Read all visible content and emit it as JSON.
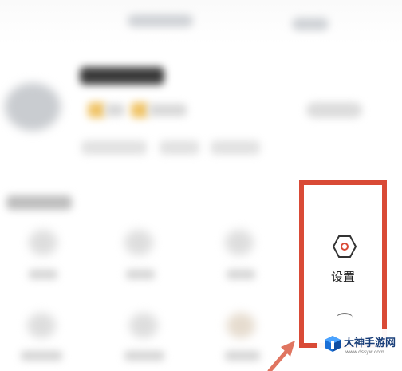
{
  "menu": {
    "settings": {
      "label": "设置",
      "icon": "settings-hexagon-icon"
    },
    "highlight_color": "#d94a36"
  },
  "watermark": {
    "title": "大神手游网",
    "url": "www.dssyw.com",
    "color": "#1a3f7a"
  }
}
